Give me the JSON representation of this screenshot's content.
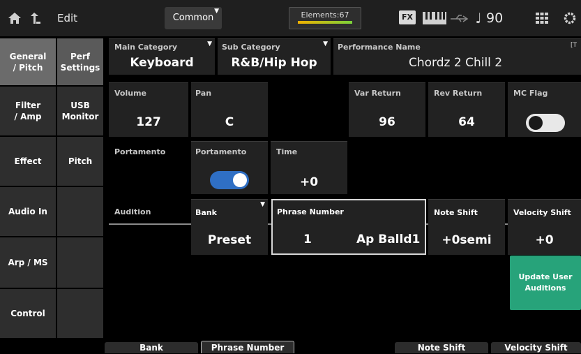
{
  "topbar": {
    "home_icon": "home-icon",
    "back_icon": "back-arrow-icon",
    "mode": "Edit",
    "common_label": "Common",
    "elements_label": "Elements:67",
    "fx_label": "FX",
    "keyboard_icon": "keyboard-icon",
    "usb_icon": "usb-icon",
    "tempo_icon": "quarter-note-icon",
    "tempo": "90",
    "grid_icon": "grid-icon",
    "settings_icon": "gear-icon"
  },
  "nav_main": [
    {
      "line1": "General",
      "line2": "/ Pitch"
    },
    {
      "line1": "Filter",
      "line2": "/ Amp"
    },
    {
      "line1": "Effect",
      "line2": ""
    },
    {
      "line1": "Audio In",
      "line2": ""
    },
    {
      "line1": "Arp / MS",
      "line2": ""
    },
    {
      "line1": "Control",
      "line2": ""
    }
  ],
  "nav_sub": [
    {
      "line1": "Perf",
      "line2": "Settings"
    },
    {
      "line1": "USB",
      "line2": "Monitor"
    },
    {
      "line1": "Pitch",
      "line2": ""
    }
  ],
  "header": {
    "main_category_label": "Main Category",
    "main_category_value": "Keyboard",
    "sub_category_label": "Sub Category",
    "sub_category_value": "R&B/Hip Hop",
    "performance_name_label": "Performance Name",
    "performance_name_value": "Chordz 2 Chill 2",
    "edit_mark": "[T"
  },
  "params": {
    "volume_label": "Volume",
    "volume_value": "127",
    "pan_label": "Pan",
    "pan_value": "C",
    "var_return_label": "Var Return",
    "var_return_value": "96",
    "rev_return_label": "Rev Return",
    "rev_return_value": "64",
    "mc_flag_label": "MC Flag",
    "mc_flag_on": false,
    "portamento_section_label": "Portamento",
    "portamento_label": "Portamento",
    "portamento_on": true,
    "time_label": "Time",
    "time_value": "+0"
  },
  "audition": {
    "section_label": "Audition",
    "bank_label": "Bank",
    "bank_value": "Preset",
    "phrase_number_label": "Phrase Number",
    "phrase_number_value": "1",
    "phrase_name": "Ap Balld1",
    "note_shift_label": "Note Shift",
    "note_shift_value": "+0semi",
    "velocity_shift_label": "Velocity Shift",
    "velocity_shift_value": "+0",
    "update_button_line1": "Update User",
    "update_button_line2": "Auditions"
  },
  "bottom_buttons": {
    "bank": "Bank",
    "phrase_number": "Phrase Number",
    "note_shift": "Note Shift",
    "velocity_shift": "Velocity Shift"
  },
  "colors": {
    "toggle_on": "#2f6fc4",
    "update_button": "#27a37a"
  }
}
